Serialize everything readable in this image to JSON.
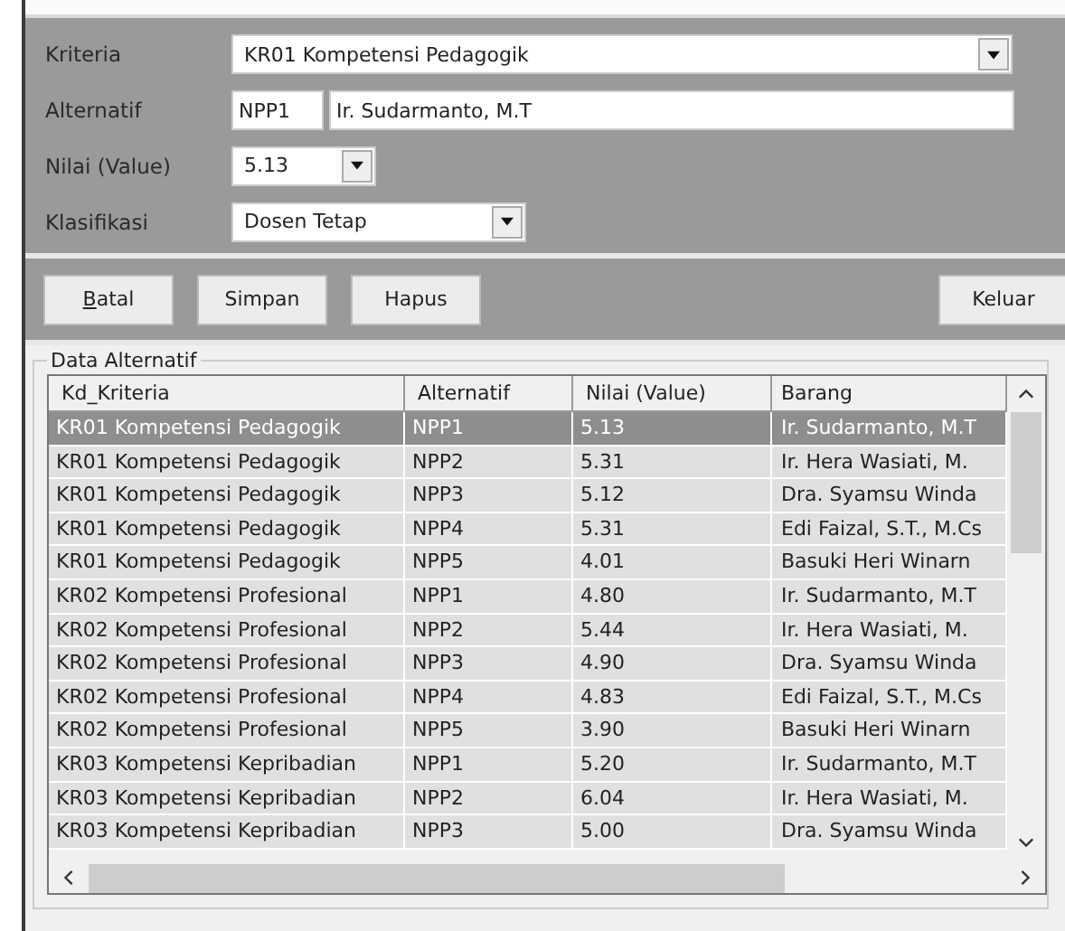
{
  "form": {
    "fields": [
      {
        "kind": "combo",
        "label": "Kriteria",
        "value": "KR01 Kompetensi Pedagogik"
      },
      {
        "kind": "pair",
        "label": "Alternatif",
        "code": "NPP1",
        "value": "Ir. Sudarmanto, M.T"
      },
      {
        "kind": "combo",
        "label": "Nilai (Value)",
        "value": "5.13"
      },
      {
        "kind": "combo",
        "label": "Klasifikasi",
        "value": "Dosen Tetap"
      }
    ]
  },
  "buttons": [
    {
      "label": "Batal"
    },
    {
      "label": "Simpan"
    },
    {
      "label": "Hapus"
    },
    {
      "label": "Keluar"
    }
  ],
  "group": {
    "title": "Data Alternatif"
  },
  "table": {
    "columns": [
      "Kd_Kriteria",
      "Alternatif",
      "Nilai (Value)",
      "Barang"
    ],
    "rows": [
      {
        "cells": [
          "KR01 Kompetensi Pedagogik",
          "NPP1",
          "5.13",
          "Ir. Sudarmanto, M.T"
        ],
        "selected": true
      },
      {
        "cells": [
          "KR01 Kompetensi Pedagogik",
          "NPP2",
          "5.31",
          "Ir. Hera Wasiati, M."
        ],
        "selected": false
      },
      {
        "cells": [
          "KR01 Kompetensi Pedagogik",
          "NPP3",
          "5.12",
          "Dra. Syamsu Winda"
        ],
        "selected": false
      },
      {
        "cells": [
          "KR01 Kompetensi Pedagogik",
          "NPP4",
          "5.31",
          "Edi Faizal, S.T., M.Cs"
        ],
        "selected": false
      },
      {
        "cells": [
          "KR01 Kompetensi Pedagogik",
          "NPP5",
          "4.01",
          "Basuki Heri Winarn"
        ],
        "selected": false
      },
      {
        "cells": [
          "KR02 Kompetensi Profesional",
          "NPP1",
          "4.80",
          "Ir. Sudarmanto, M.T"
        ],
        "selected": false
      },
      {
        "cells": [
          "KR02 Kompetensi Profesional",
          "NPP2",
          "5.44",
          "Ir. Hera Wasiati, M."
        ],
        "selected": false
      },
      {
        "cells": [
          "KR02 Kompetensi Profesional",
          "NPP3",
          "4.90",
          "Dra. Syamsu Winda"
        ],
        "selected": false
      },
      {
        "cells": [
          "KR02 Kompetensi Profesional",
          "NPP4",
          "4.83",
          "Edi Faizal, S.T., M.Cs"
        ],
        "selected": false
      },
      {
        "cells": [
          "KR02 Kompetensi Profesional",
          "NPP5",
          "3.90",
          "Basuki Heri Winarn"
        ],
        "selected": false
      },
      {
        "cells": [
          "KR03 Kompetensi Kepribadian",
          "NPP1",
          "5.20",
          "Ir. Sudarmanto, M.T"
        ],
        "selected": false
      },
      {
        "cells": [
          "KR03 Kompetensi Kepribadian",
          "NPP2",
          "6.04",
          "Ir. Hera Wasiati, M."
        ],
        "selected": false
      },
      {
        "cells": [
          "KR03 Kompetensi Kepribadian",
          "NPP3",
          "5.00",
          "Dra. Syamsu Winda"
        ],
        "selected": false
      }
    ]
  }
}
